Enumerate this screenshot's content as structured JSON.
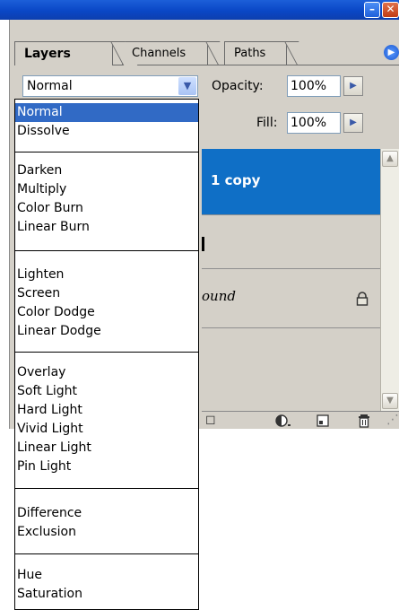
{
  "tabs": [
    {
      "label": "Layers",
      "active": true
    },
    {
      "label": "Channels",
      "active": false
    },
    {
      "label": "Paths",
      "active": false
    }
  ],
  "blend_mode": {
    "selected": "Normal"
  },
  "opacity": {
    "label": "Opacity:",
    "value": "100%"
  },
  "fill": {
    "label": "Fill:",
    "value": "100%"
  },
  "layers": [
    {
      "name": "1 copy",
      "selected": true
    },
    {
      "name": "",
      "selected": false
    },
    {
      "name": "ound",
      "selected": false,
      "locked": true
    },
    {
      "name": "",
      "selected": false
    }
  ],
  "blend_modes": [
    [
      "Normal",
      "Dissolve"
    ],
    [
      "Darken",
      "Multiply",
      "Color Burn",
      "Linear Burn"
    ],
    [
      "Lighten",
      "Screen",
      "Color Dodge",
      "Linear Dodge"
    ],
    [
      "Overlay",
      "Soft Light",
      "Hard Light",
      "Vivid Light",
      "Linear Light",
      "Pin Light"
    ],
    [
      "Difference",
      "Exclusion"
    ],
    [
      "Hue",
      "Saturation"
    ]
  ],
  "icons": {
    "minimize": "minimize-icon",
    "close": "close-icon",
    "panel_menu": "panel-menu-icon",
    "dropdown": "chevron-down-icon",
    "stepper": "triangle-right-icon",
    "lock": "lock-icon",
    "adjustment": "adjustment-layer-icon",
    "new_layer": "new-layer-icon",
    "trash": "trash-icon"
  },
  "colors": {
    "titlebar": "#0a47c6",
    "selection": "#316ac5",
    "layer_selected": "#0f6fc6",
    "panel_bg": "#d4d0c8"
  }
}
